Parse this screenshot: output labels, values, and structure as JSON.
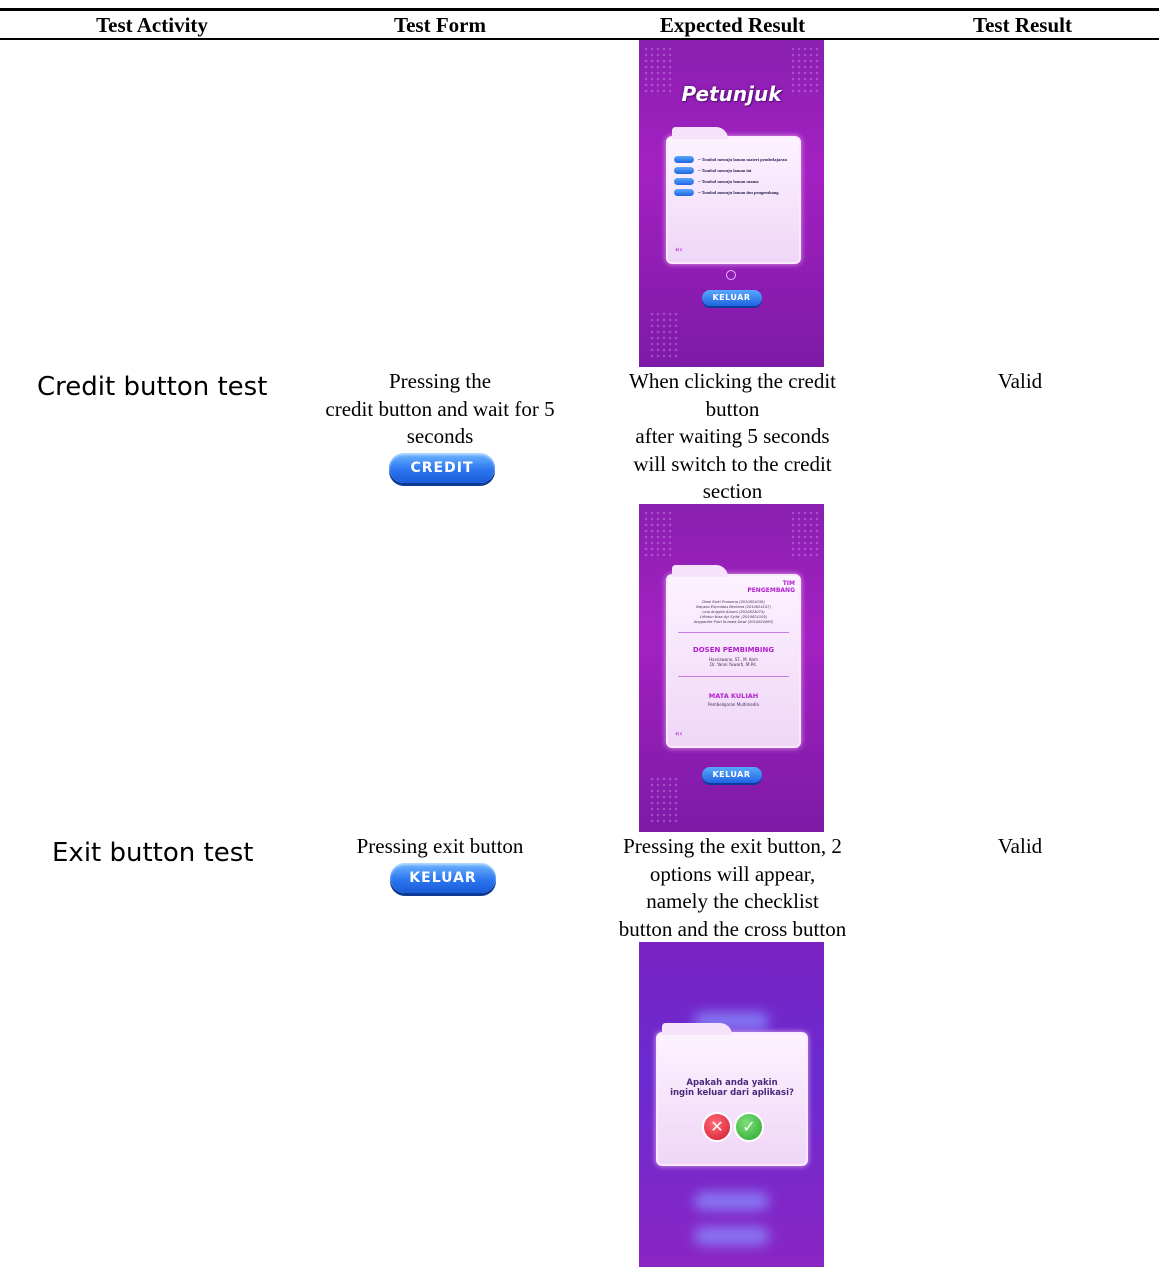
{
  "headers": {
    "activity": "Test Activity",
    "form": "Test Form",
    "expected": "Expected Result",
    "result": "Test Result"
  },
  "rows": [
    {
      "activity": "Credit button test",
      "form_lines": [
        "Pressing the",
        "credit button and wait for 5",
        "seconds"
      ],
      "button_label": "CREDIT",
      "expected_lines": [
        "When clicking the credit",
        "button",
        "after waiting 5 seconds",
        "will switch to the credit",
        "section"
      ],
      "result": "Valid"
    },
    {
      "activity": "Exit button test",
      "form_lines": [
        "Pressing exit button"
      ],
      "button_label": "KELUAR",
      "expected_lines": [
        "Pressing the exit button, 2",
        "options will appear,",
        "namely the checklist",
        "button and the cross button"
      ],
      "result": "Valid"
    }
  ],
  "screens": {
    "petunjuk": {
      "title": "Petunjuk",
      "items": [
        {
          "btn": "MULAI",
          "text": "= Tombol menuju laman materi pembelajaran"
        },
        {
          "btn": "PETUNJUK",
          "text": "= Tombol menuju laman ini"
        },
        {
          "btn": "CREDIT",
          "text": "= Tombol menuju laman utama"
        },
        {
          "btn": "KELUAR",
          "text": "= Tombol menuju laman tim pengembang"
        }
      ],
      "exit_label": "KELUAR"
    },
    "credit": {
      "team_title": "TIM PENGEMBANG",
      "team_members": [
        "Dewi Rizki Pramana (2010824038)",
        "Nayaka Ellyndaus Berliana (2010824107)",
        "Lina Anggita Alizani (2010824074)",
        "Liffatun Nisa Ayi Syifa' (2010824105)",
        "Anggarete Putri Kumala Dewi (2010824063)"
      ],
      "supervisor_title": "DOSEN PEMBIMBING",
      "supervisors": [
        "Harsiswono, ST., M. Kom",
        "Dr. Yanni Yuwarti, M.Pd."
      ],
      "course_title": "MATA KULIAH",
      "course": "Pembelajaran Multimedia",
      "exit_label": "KELUAR"
    },
    "exit_dialog": {
      "question_line1": "Apakah anda yakin",
      "question_line2": "ingin keluar dari aplikasi?",
      "cancel_glyph": "✕",
      "confirm_glyph": "✓"
    }
  },
  "colors": {
    "screen_purple": "#9a20bb",
    "button_blue": "#2d77f0",
    "cancel_red": "#e2293f",
    "confirm_green": "#3bbf3f"
  }
}
